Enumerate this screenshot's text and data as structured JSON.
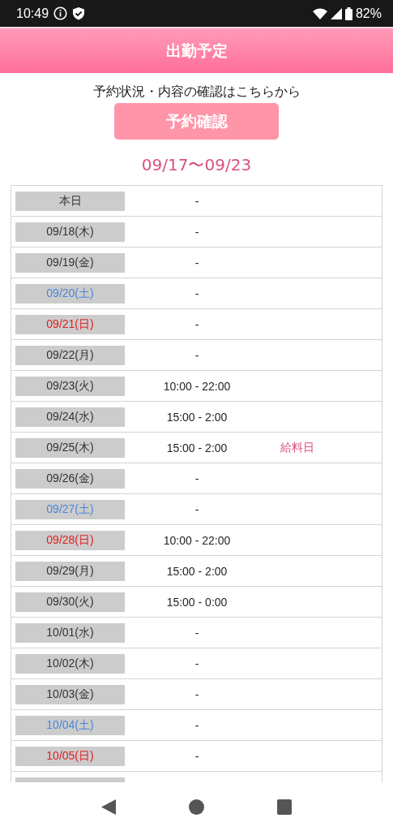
{
  "status_bar": {
    "time": "10:49",
    "battery": "82%"
  },
  "header": {
    "title": "出勤予定"
  },
  "notice": "予約状況・内容の確認はこちらから",
  "reserve_button": "予約確認",
  "range": "09/17〜09/23",
  "rows": [
    {
      "date": "本日",
      "kind": "weekday",
      "time": "-"
    },
    {
      "date": "09/18(木)",
      "kind": "weekday",
      "time": "-"
    },
    {
      "date": "09/19(金)",
      "kind": "weekday",
      "time": "-"
    },
    {
      "date": "09/20(土)",
      "kind": "saturday",
      "time": "-"
    },
    {
      "date": "09/21(日)",
      "kind": "sunday",
      "time": "-"
    },
    {
      "date": "09/22(月)",
      "kind": "weekday",
      "time": "-"
    },
    {
      "date": "09/23(火)",
      "kind": "weekday",
      "time": "10:00 - 22:00"
    },
    {
      "date": "09/24(水)",
      "kind": "weekday",
      "time": "15:00 - 2:00"
    },
    {
      "date": "09/25(木)",
      "kind": "weekday",
      "time": "15:00 - 2:00",
      "note": "給料日"
    },
    {
      "date": "09/26(金)",
      "kind": "weekday",
      "time": "-"
    },
    {
      "date": "09/27(土)",
      "kind": "saturday",
      "time": "-"
    },
    {
      "date": "09/28(日)",
      "kind": "sunday",
      "time": "10:00 - 22:00"
    },
    {
      "date": "09/29(月)",
      "kind": "weekday",
      "time": "15:00 - 2:00"
    },
    {
      "date": "09/30(火)",
      "kind": "weekday",
      "time": "15:00 - 0:00"
    },
    {
      "date": "10/01(水)",
      "kind": "weekday",
      "time": "-"
    },
    {
      "date": "10/02(木)",
      "kind": "weekday",
      "time": "-"
    },
    {
      "date": "10/03(金)",
      "kind": "weekday",
      "time": "-"
    },
    {
      "date": "10/04(土)",
      "kind": "saturday",
      "time": "-"
    },
    {
      "date": "10/05(日)",
      "kind": "sunday",
      "time": "-"
    }
  ]
}
